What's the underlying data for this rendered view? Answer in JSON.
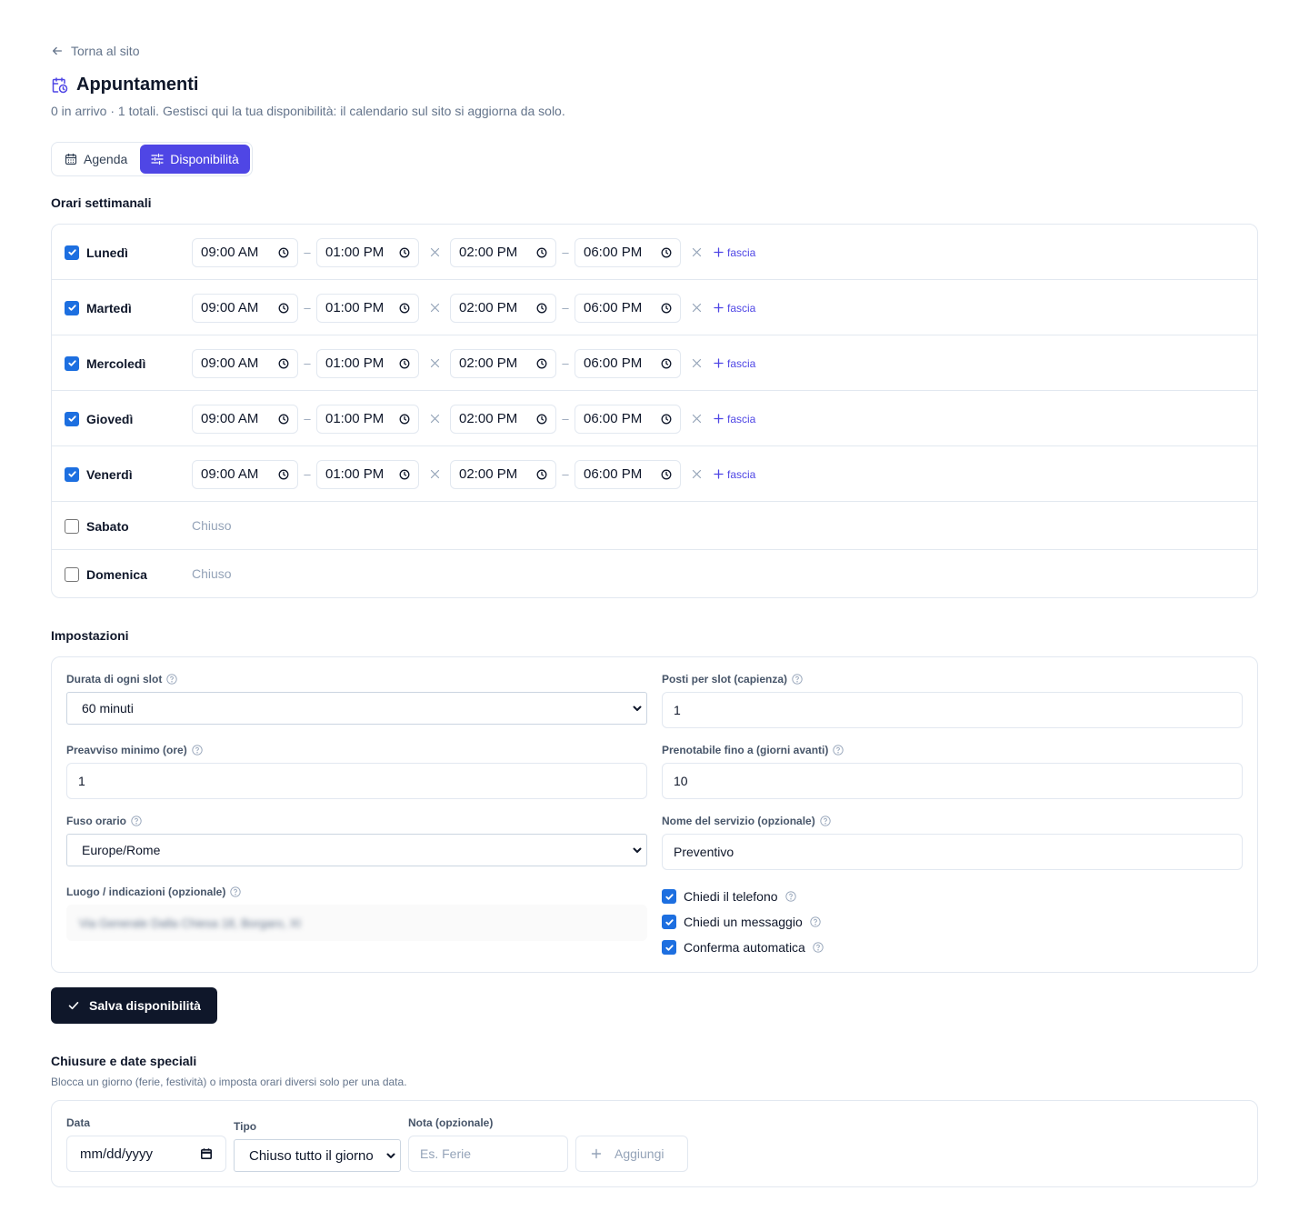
{
  "back_link": "Torna al sito",
  "title": "Appuntamenti",
  "subtitle": "0 in arrivo · 1 totali. Gestisci qui la tua disponibilità: il calendario sul sito si aggiorna da solo.",
  "tabs": [
    {
      "label": "Agenda",
      "icon": "calendar-icon",
      "active": false
    },
    {
      "label": "Disponibilità",
      "icon": "sliders-icon",
      "active": true
    }
  ],
  "weekly": {
    "heading": "Orari settimanali",
    "closed_label": "Chiuso",
    "add_label": "fascia",
    "days": [
      {
        "name": "Lunedì",
        "enabled": true,
        "slots": [
          [
            "09:00 AM",
            "01:00 PM"
          ],
          [
            "02:00 PM",
            "06:00 PM"
          ]
        ]
      },
      {
        "name": "Martedì",
        "enabled": true,
        "slots": [
          [
            "09:00 AM",
            "01:00 PM"
          ],
          [
            "02:00 PM",
            "06:00 PM"
          ]
        ]
      },
      {
        "name": "Mercoledì",
        "enabled": true,
        "slots": [
          [
            "09:00 AM",
            "01:00 PM"
          ],
          [
            "02:00 PM",
            "06:00 PM"
          ]
        ]
      },
      {
        "name": "Giovedì",
        "enabled": true,
        "slots": [
          [
            "09:00 AM",
            "01:00 PM"
          ],
          [
            "02:00 PM",
            "06:00 PM"
          ]
        ]
      },
      {
        "name": "Venerdì",
        "enabled": true,
        "slots": [
          [
            "09:00 AM",
            "01:00 PM"
          ],
          [
            "02:00 PM",
            "06:00 PM"
          ]
        ]
      },
      {
        "name": "Sabato",
        "enabled": false,
        "slots": []
      },
      {
        "name": "Domenica",
        "enabled": false,
        "slots": []
      }
    ]
  },
  "settings": {
    "heading": "Impostazioni",
    "slot_duration": {
      "label": "Durata di ogni slot",
      "value": "60 minuti"
    },
    "capacity": {
      "label": "Posti per slot (capienza)",
      "value": "1"
    },
    "min_notice": {
      "label": "Preavviso minimo (ore)",
      "value": "1"
    },
    "max_days": {
      "label": "Prenotabile fino a (giorni avanti)",
      "value": "10"
    },
    "timezone": {
      "label": "Fuso orario",
      "value": "Europe/Rome"
    },
    "service_name": {
      "label": "Nome del servizio (opzionale)",
      "value": "Preventivo"
    },
    "location": {
      "label": "Luogo / indicazioni (opzionale)",
      "value": "Via Generale Dalla Chiesa 18, Borgaro, XI"
    },
    "checks": [
      {
        "label": "Chiedi il telefono",
        "checked": true
      },
      {
        "label": "Chiedi un messaggio",
        "checked": true
      },
      {
        "label": "Conferma automatica",
        "checked": true
      }
    ]
  },
  "save_button": "Salva disponibilità",
  "special": {
    "heading": "Chiusure e date speciali",
    "description": "Blocca un giorno (ferie, festività) o imposta orari diversi solo per una data.",
    "date": {
      "label": "Data",
      "value": "mm/dd/yyyy"
    },
    "type": {
      "label": "Tipo",
      "value": "Chiuso tutto il giorno"
    },
    "note": {
      "label": "Nota (opzionale)",
      "placeholder": "Es. Ferie"
    },
    "add_button": "Aggiungi"
  },
  "colors": {
    "accent": "#4f46e5",
    "dark": "#0f172a",
    "checkbox": "#1d6fe0"
  }
}
